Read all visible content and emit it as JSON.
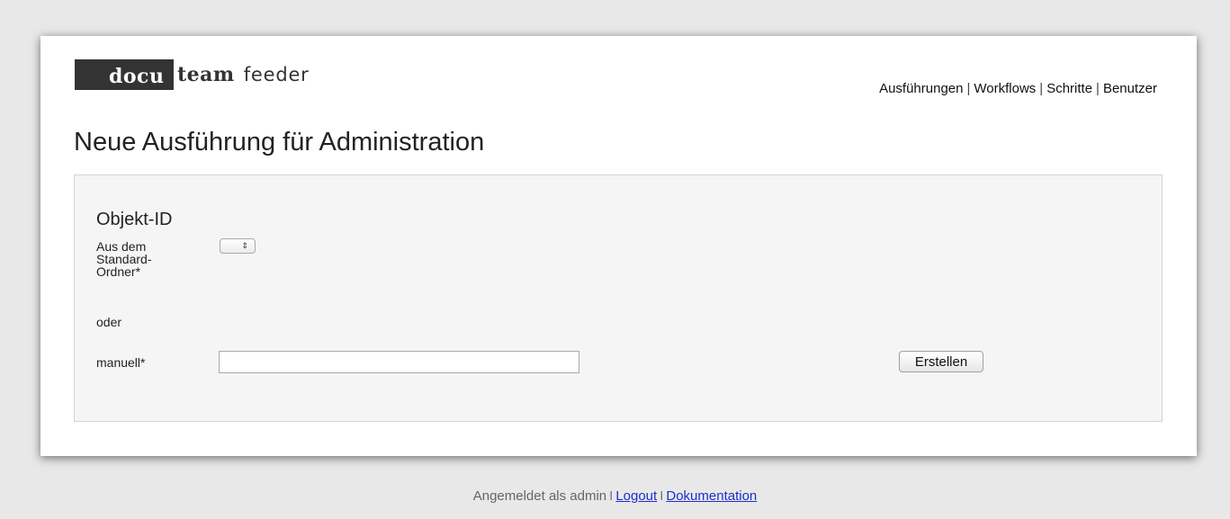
{
  "brand": {
    "logo_highlight": "docu",
    "logo_rest": "team",
    "product": "feeder"
  },
  "nav": {
    "items": [
      {
        "label": "Ausführungen"
      },
      {
        "label": "Workflows"
      },
      {
        "label": "Schritte"
      },
      {
        "label": "Benutzer"
      }
    ],
    "separator": "|"
  },
  "page": {
    "title": "Neue Ausführung für Administration"
  },
  "form": {
    "section_title": "Objekt-ID",
    "folder_label": "Aus dem Standard-Ordner*",
    "select_glyph": "⇕",
    "or_label": "oder",
    "manual_label": "manuell*",
    "manual_value": "",
    "submit_label": "Erstellen"
  },
  "footer": {
    "prefix": "Angemeldet als admin",
    "separator": "I",
    "logout_label": "Logout",
    "docs_label": "Dokumentation"
  }
}
